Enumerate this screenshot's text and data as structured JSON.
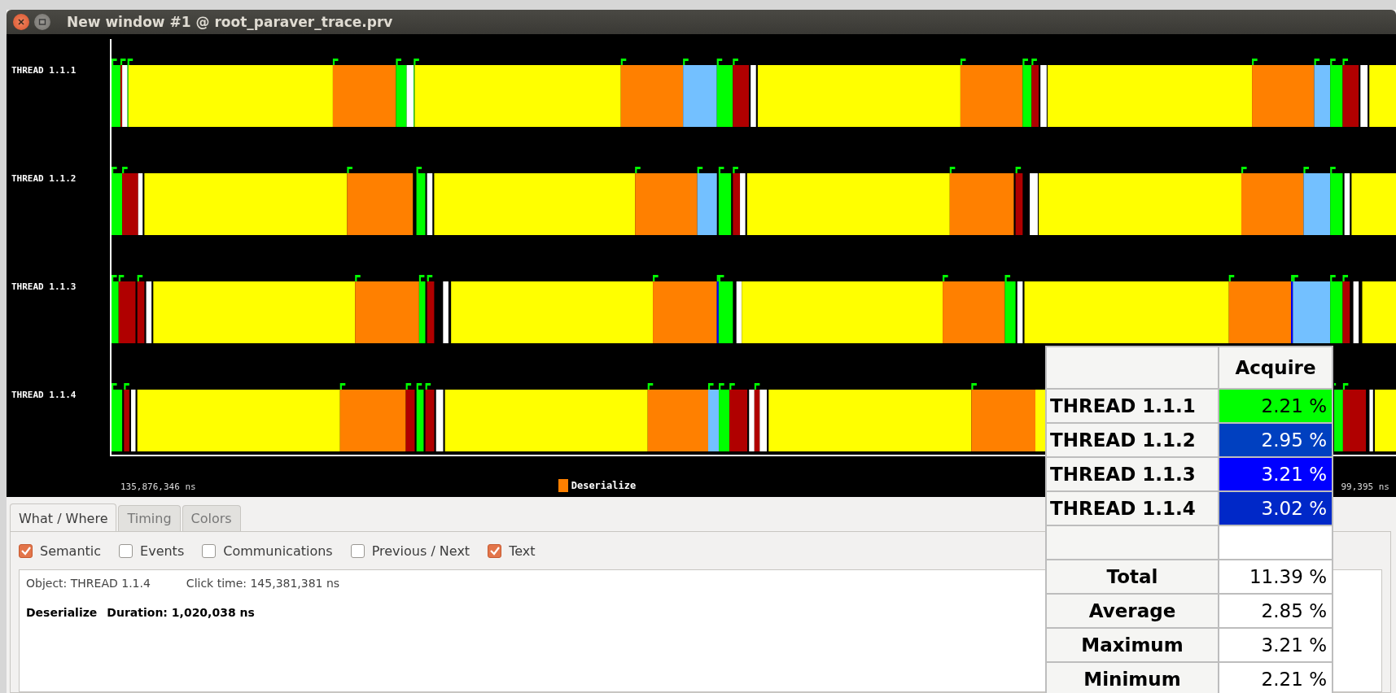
{
  "window": {
    "title": "New window #1 @ root_paraver_trace.prv"
  },
  "threads": [
    {
      "label": "THREAD 1.1.1"
    },
    {
      "label": "THREAD 1.1.2"
    },
    {
      "label": "THREAD 1.1.3"
    },
    {
      "label": "THREAD 1.1.4"
    }
  ],
  "axis": {
    "start": "135,876,346 ns",
    "end": "99,395 ns"
  },
  "legend": {
    "label": "Deserialize",
    "color": "#ff8000"
  },
  "tabs": [
    {
      "label": "What / Where",
      "selected": true
    },
    {
      "label": "Timing",
      "selected": false
    },
    {
      "label": "Colors",
      "selected": false
    }
  ],
  "options": [
    {
      "label": "Semantic",
      "checked": true
    },
    {
      "label": "Events",
      "checked": false
    },
    {
      "label": "Communications",
      "checked": false
    },
    {
      "label": "Previous / Next",
      "checked": false
    },
    {
      "label": "Text",
      "checked": true
    }
  ],
  "info": {
    "object": "Object: THREAD 1.1.4",
    "click_time": "Click time: 145,381,381 ns",
    "state": "Deserialize",
    "duration": "Duration: 1,020,038 ns"
  },
  "table": {
    "column": "Acquire",
    "rows": [
      {
        "label": "THREAD 1.1.1",
        "value": "2.21 %",
        "color": "#00ff00"
      },
      {
        "label": "THREAD 1.1.2",
        "value": "2.95 %",
        "color": "#0040c0"
      },
      {
        "label": "THREAD 1.1.3",
        "value": "3.21 %",
        "color": "#0000ff"
      },
      {
        "label": "THREAD 1.1.4",
        "value": "3.02 %",
        "color": "#0028c8"
      }
    ],
    "stats": [
      {
        "label": "Total",
        "value": "11.39 %"
      },
      {
        "label": "Average",
        "value": "2.85 %"
      },
      {
        "label": "Maximum",
        "value": "3.21 %"
      },
      {
        "label": "Minimum",
        "value": "2.21 %"
      }
    ]
  }
}
